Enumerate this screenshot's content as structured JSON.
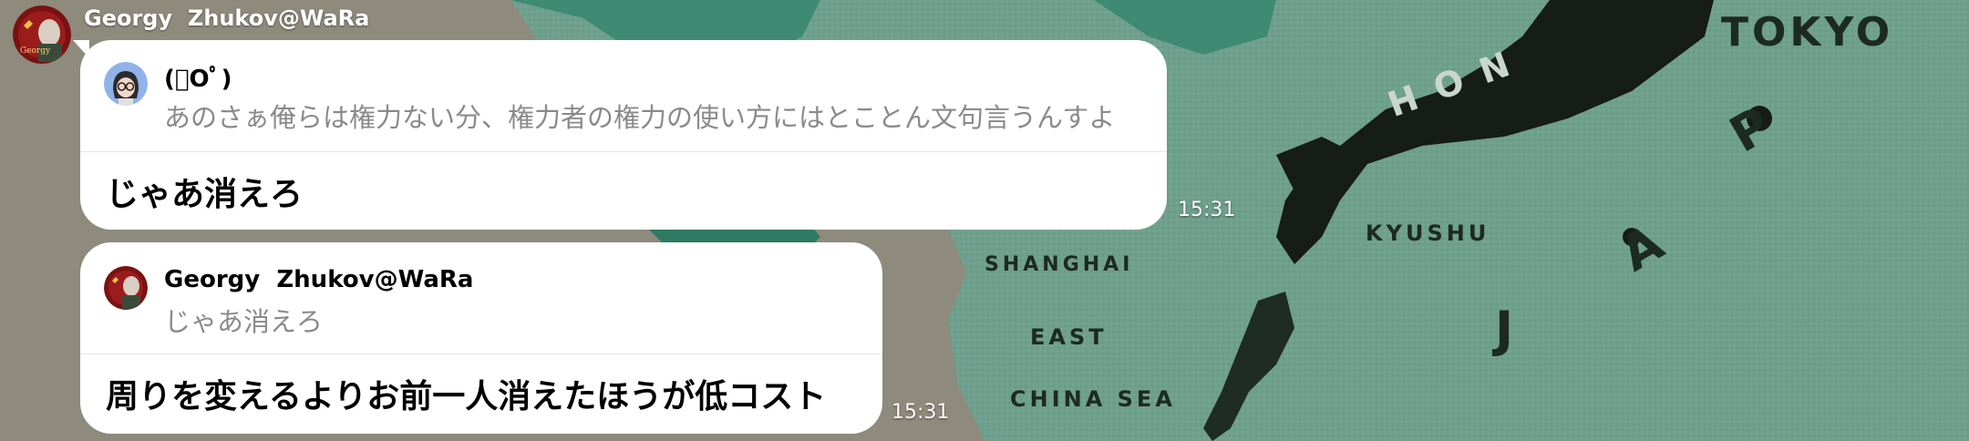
{
  "sender": {
    "name": "Georgy  Zhukov@WaRa"
  },
  "map_labels": {
    "tokyo": "TOKYO",
    "honshu": "H O N",
    "kyushu": "KYUSHU",
    "shanghai": "SHANGHAI",
    "east": "EAST",
    "china_sea": "CHINA SEA",
    "japan_j": "J",
    "japan_a": "A",
    "japan_p": "P"
  },
  "messages": [
    {
      "reply_to": {
        "name": "(ﾟOﾟ)",
        "text": "あのさぁ俺らは権力ない分、権力者の権力の使い方にはとことん文句言うんすよ",
        "avatar_icon": "glasses-girl-avatar-icon"
      },
      "text": "じゃあ消えろ",
      "time": "15:31"
    },
    {
      "reply_to": {
        "name": "Georgy  Zhukov@WaRa",
        "text": "じゃあ消えろ",
        "avatar_icon": "soviet-portrait-avatar-icon"
      },
      "text": "周りを変えるよりお前一人消えたほうが低コスト",
      "time": "15:31"
    }
  ],
  "colors": {
    "sea": "#6f9f8d",
    "land": "#8a8a7a",
    "japan": "#161c18",
    "bubble": "#ffffff",
    "quote_text": "#8a8a8a"
  }
}
